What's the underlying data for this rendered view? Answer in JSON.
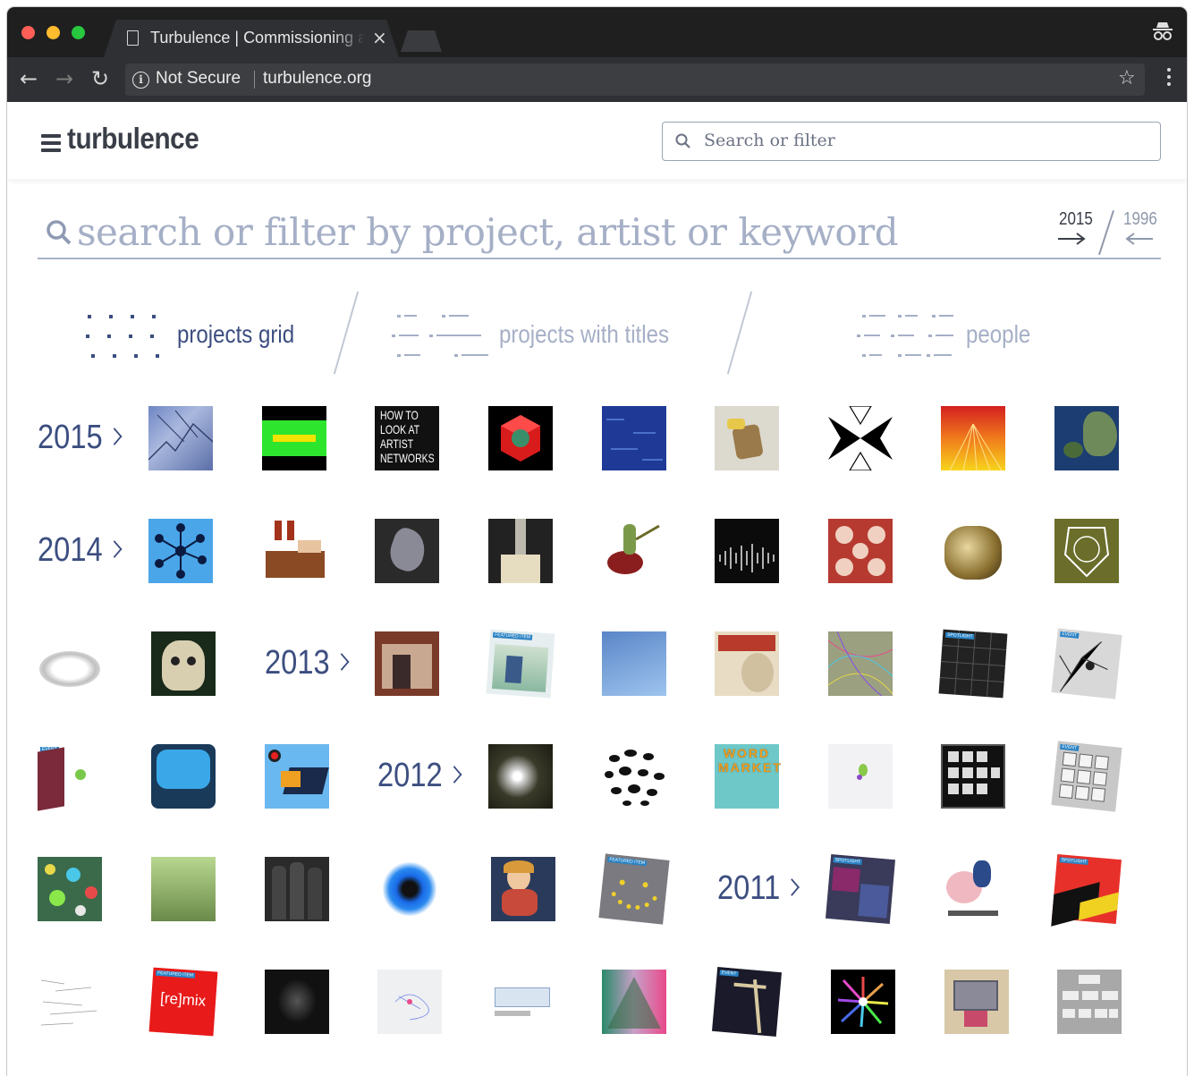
{
  "browser": {
    "tab_title": "Turbulence | Commissioning and Supporting Net Art",
    "tab_close": "×",
    "security_label": "Not Secure",
    "url": "turbulence.org",
    "star": "☆"
  },
  "header": {
    "logo": "turbulence",
    "search_placeholder": "Search or filter"
  },
  "main_search": {
    "placeholder": "search or filter by project, artist or keyword",
    "sort_newest": "2015",
    "sort_oldest": "1996"
  },
  "view_tabs": [
    {
      "label": "projects grid",
      "active": true
    },
    {
      "label": "projects with titles",
      "active": false
    },
    {
      "label": "people",
      "active": false
    }
  ],
  "years": [
    "2015",
    "2014",
    "2013",
    "2012",
    "2011"
  ],
  "thumbnail_labels": {
    "how_to": "HOW TO LOOK AT ARTIST NETWORKS",
    "word_market": "WORD MARKET",
    "remix": "[re]mix",
    "featured": "FEATURED ITEM",
    "spotlight": "SPOTLIGHT",
    "event": "EVENT"
  },
  "colors": {
    "active_tab": "#3c4e80",
    "inactive_tab": "#a5afc6",
    "chrome_dark": "#1f1f20",
    "chrome_toolbar": "#2f3033"
  }
}
